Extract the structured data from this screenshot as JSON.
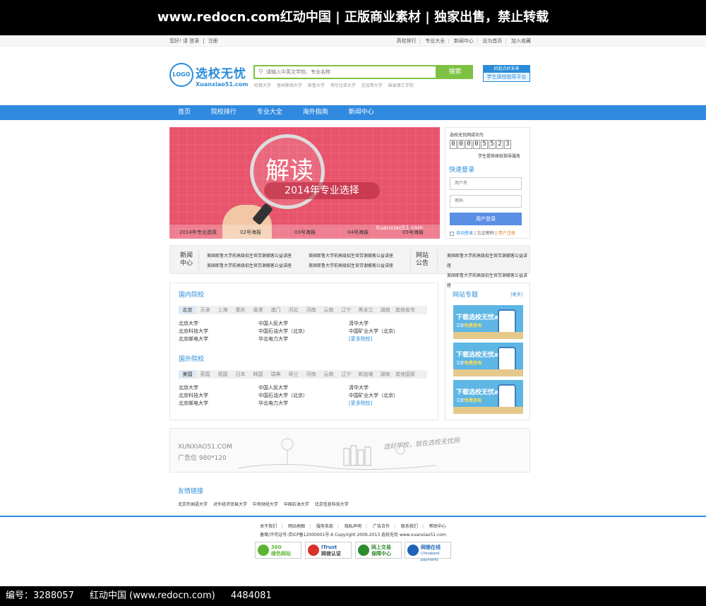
{
  "banner": {
    "top_text": "www.redocn.com红动中国 | 正版商业素材 | 独家出售，禁止转载",
    "bottom": {
      "id": "编号：3288057",
      "site": "红动中国 (www.redocn.com)",
      "num": "4484081"
    }
  },
  "topbar": {
    "greeting": "您好! 请 登录",
    "register": "注册",
    "links": [
      "高校排行",
      "专业大全",
      "新闻中心",
      "设为首页",
      "加入收藏"
    ]
  },
  "header": {
    "logo": "LOGO",
    "brand_cn": "选校无忧",
    "brand_en": "Xuanxiao51.com",
    "search_placeholder": "请输入中英文学校、专业名称",
    "search_button": "搜索",
    "hot_words": [
      "哈佛大学",
      "普林斯顿大学",
      "耶鲁大学",
      "哥伦比亚大学",
      "芝加哥大学",
      "麻省理工学院"
    ],
    "ad_top": "好起点好未来",
    "ad_bottom": "学生择校指导平台"
  },
  "nav": [
    "首页",
    "院校排行",
    "专业大全",
    "海外指南",
    "新闻中心"
  ],
  "hero": {
    "big": "解读",
    "sub": "2014年专业选择",
    "site": "Xuanxiao51.com",
    "tabs": [
      "2014年专业选择",
      "02号海报",
      "03号海报",
      "04号海报",
      "05号海报"
    ]
  },
  "login": {
    "caption": "选校无忧网成功为",
    "digits": [
      "0",
      "0",
      "0",
      "0",
      "5",
      "5",
      "2",
      "3"
    ],
    "service": "学生提供择校指导服务",
    "title": "快速登录",
    "user_ph": "用户名",
    "pass_ph": "密码",
    "button": "用户登录",
    "auto": "自动登录",
    "forgot": "忘记密码",
    "signup": "用户注册"
  },
  "newsbar": {
    "news_label": "新闻\n中心",
    "notice_label": "网站\n公告",
    "item": "美国耶鲁大学前高级招生官劳谢娜客公益讲座"
  },
  "domestic": {
    "title": "国内院校",
    "tabs": [
      "北京",
      "天津",
      "上海",
      "重庆",
      "香港",
      "澳门",
      "河北",
      "河南",
      "云南",
      "辽宁",
      "黑龙江",
      "湖南",
      "其他省市"
    ],
    "col1": [
      "北京大学",
      "北京科技大学",
      "北京邮电大学"
    ],
    "col2": [
      "中国人民大学",
      "中国石油大学（北京）",
      "华北电力大学"
    ],
    "col3": [
      "清华大学",
      "中国矿业大学（北京）",
      "[更多院校]"
    ]
  },
  "foreign": {
    "title": "国外院校",
    "tabs": [
      "美国",
      "英国",
      "德国",
      "日本",
      "韩国",
      "瑞典",
      "荷兰",
      "河南",
      "云南",
      "辽宁",
      "新加坡",
      "湖南",
      "其他国家"
    ],
    "col1": [
      "北京大学",
      "北京科技大学",
      "北京邮电大学"
    ],
    "col2": [
      "中国人民大学",
      "中国石油大学（北京）",
      "华北电力大学"
    ],
    "col3": [
      "清华大学",
      "中国矿业大学（北京）",
      "[更多院校]"
    ]
  },
  "topics": {
    "title": "网站专题",
    "more": "[更多]",
    "promo_title": "下载选校无忧app",
    "promo_sub_a": "立即",
    "promo_sub_b": "免费咨询"
  },
  "ad": {
    "site": "XUNXIAO51.COM",
    "size": "广告位 980*120",
    "slogan": "选好学校，就在选校无忧网"
  },
  "friends": {
    "title": "友情链接",
    "links": [
      "北京外国语大学",
      "对外经济贸易大学",
      "中央财经大学",
      "中国石油大学",
      "北京信息科技大学"
    ]
  },
  "footer": {
    "links": [
      "关于我们",
      "网站地图",
      "服务条款",
      "隐私声明",
      "广告合作",
      "联系我们",
      "帮助中心"
    ],
    "copy": "备案/许可证号:京ICP备12000001号-6    Copyright 2009-2013 选校无忧 www.xuanxiao51.com",
    "badges": [
      {
        "a": "360",
        "b": "绿色网站",
        "color": "#5cb531"
      },
      {
        "a": "iTrust",
        "b": "网信认证",
        "color": "#d9312b"
      },
      {
        "a": "网上交易",
        "b": "保障中心",
        "color": "#2e8b2e"
      },
      {
        "a": "网银在线",
        "b": "Chinabank payments",
        "color": "#1e63b5"
      }
    ]
  }
}
